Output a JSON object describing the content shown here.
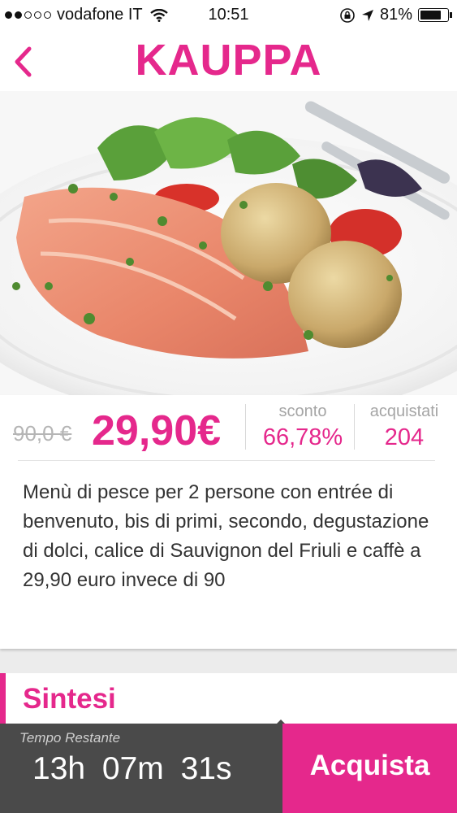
{
  "status_bar": {
    "carrier": "vodafone IT",
    "time": "10:51",
    "battery_percent": "81%",
    "battery_level": 0.81,
    "signal_bars": 2
  },
  "header": {
    "logo": "KAUPPA",
    "back_icon": "chevron-left-icon"
  },
  "offer": {
    "image": "salmon-dish-photo",
    "old_price": "90,0 €",
    "price": "29,90€",
    "discount_label": "sconto",
    "discount_value": "66,78%",
    "purchased_label": "acquistati",
    "purchased_value": "204",
    "description": "Menù di pesce per 2 persone con entrée di benvenuto, bis di primi, secondo, degustazione di dolci, calice di Sauvignon del Friuli e caffè a 29,90 euro invece di 90"
  },
  "section": {
    "title": "Sintesi"
  },
  "footer": {
    "timer_label": "Tempo Restante",
    "timer_value": "13h  07m  31s",
    "buy_label": "Acquista"
  },
  "colors": {
    "accent": "#e5288c",
    "timer_bg": "#4a4a4a"
  }
}
